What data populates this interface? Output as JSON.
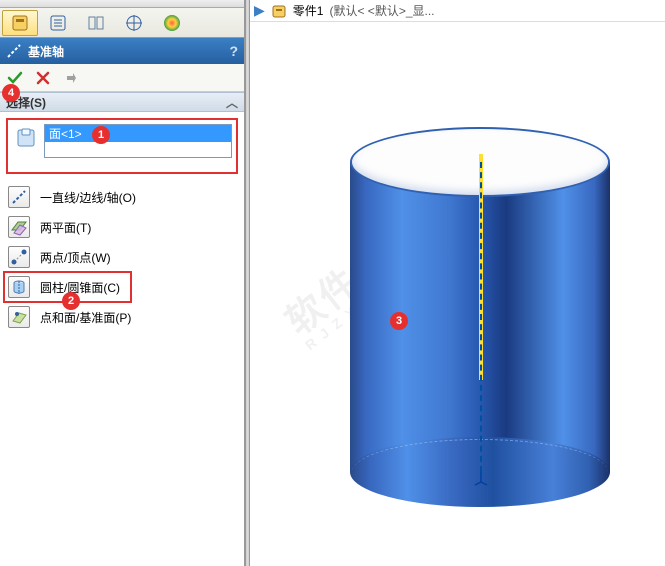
{
  "header": {
    "title": "基准轴",
    "help_glyph": "?"
  },
  "actions": {
    "ok_glyph": "✔",
    "cancel_glyph": "✕",
    "pin_glyph": "📌"
  },
  "section": {
    "label": "选择(S)",
    "chevron": "︿"
  },
  "selection": {
    "items": [
      {
        "label": "面<1>"
      }
    ]
  },
  "axis_types": [
    {
      "key": "line",
      "label": "一直线/边线/轴(O)"
    },
    {
      "key": "planes",
      "label": "两平面(T)"
    },
    {
      "key": "points",
      "label": "两点/顶点(W)"
    },
    {
      "key": "cyl",
      "label": "圆柱/圆锥面(C)"
    },
    {
      "key": "ptface",
      "label": "点和面/基准面(P)"
    }
  ],
  "breadcrumb": {
    "arrow": "▶",
    "item": "零件1",
    "suffix": "(默认< <默认>_显..."
  },
  "badges": {
    "b1": "1",
    "b2": "2",
    "b3": "3",
    "b4": "4"
  },
  "colors": {
    "accent": "#3399ff",
    "badge": "#e63030",
    "highlight": "#e03030"
  }
}
